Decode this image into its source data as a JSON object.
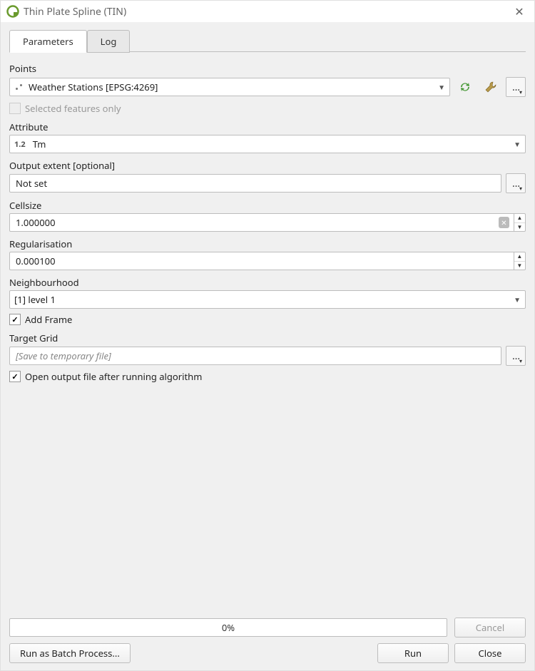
{
  "window": {
    "title": "Thin Plate Spline (TIN)"
  },
  "tabs": {
    "parameters": "Parameters",
    "log": "Log"
  },
  "form": {
    "points_label": "Points",
    "points_value": "Weather Stations [EPSG:4269]",
    "selected_only_label": "Selected features only",
    "attribute_label": "Attribute",
    "attribute_prefix": "1.2",
    "attribute_value": "Tm",
    "output_extent_label": "Output extent [optional]",
    "output_extent_value": "Not set",
    "cellsize_label": "Cellsize",
    "cellsize_value": "1.000000",
    "regularisation_label": "Regularisation",
    "regularisation_value": "0.000100",
    "neighbourhood_label": "Neighbourhood",
    "neighbourhood_value": "[1] level 1",
    "add_frame_label": "Add Frame",
    "target_grid_label": "Target Grid",
    "target_grid_placeholder": "[Save to temporary file]",
    "open_output_label": "Open output file after running algorithm"
  },
  "footer": {
    "progress_text": "0%",
    "cancel": "Cancel",
    "batch": "Run as Batch Process...",
    "run": "Run",
    "close": "Close"
  },
  "icons": {
    "refresh": "refresh-icon",
    "wrench": "wrench-icon",
    "more": "more-icon",
    "dropdown": "chevron-down-icon",
    "clear": "clear-icon"
  }
}
